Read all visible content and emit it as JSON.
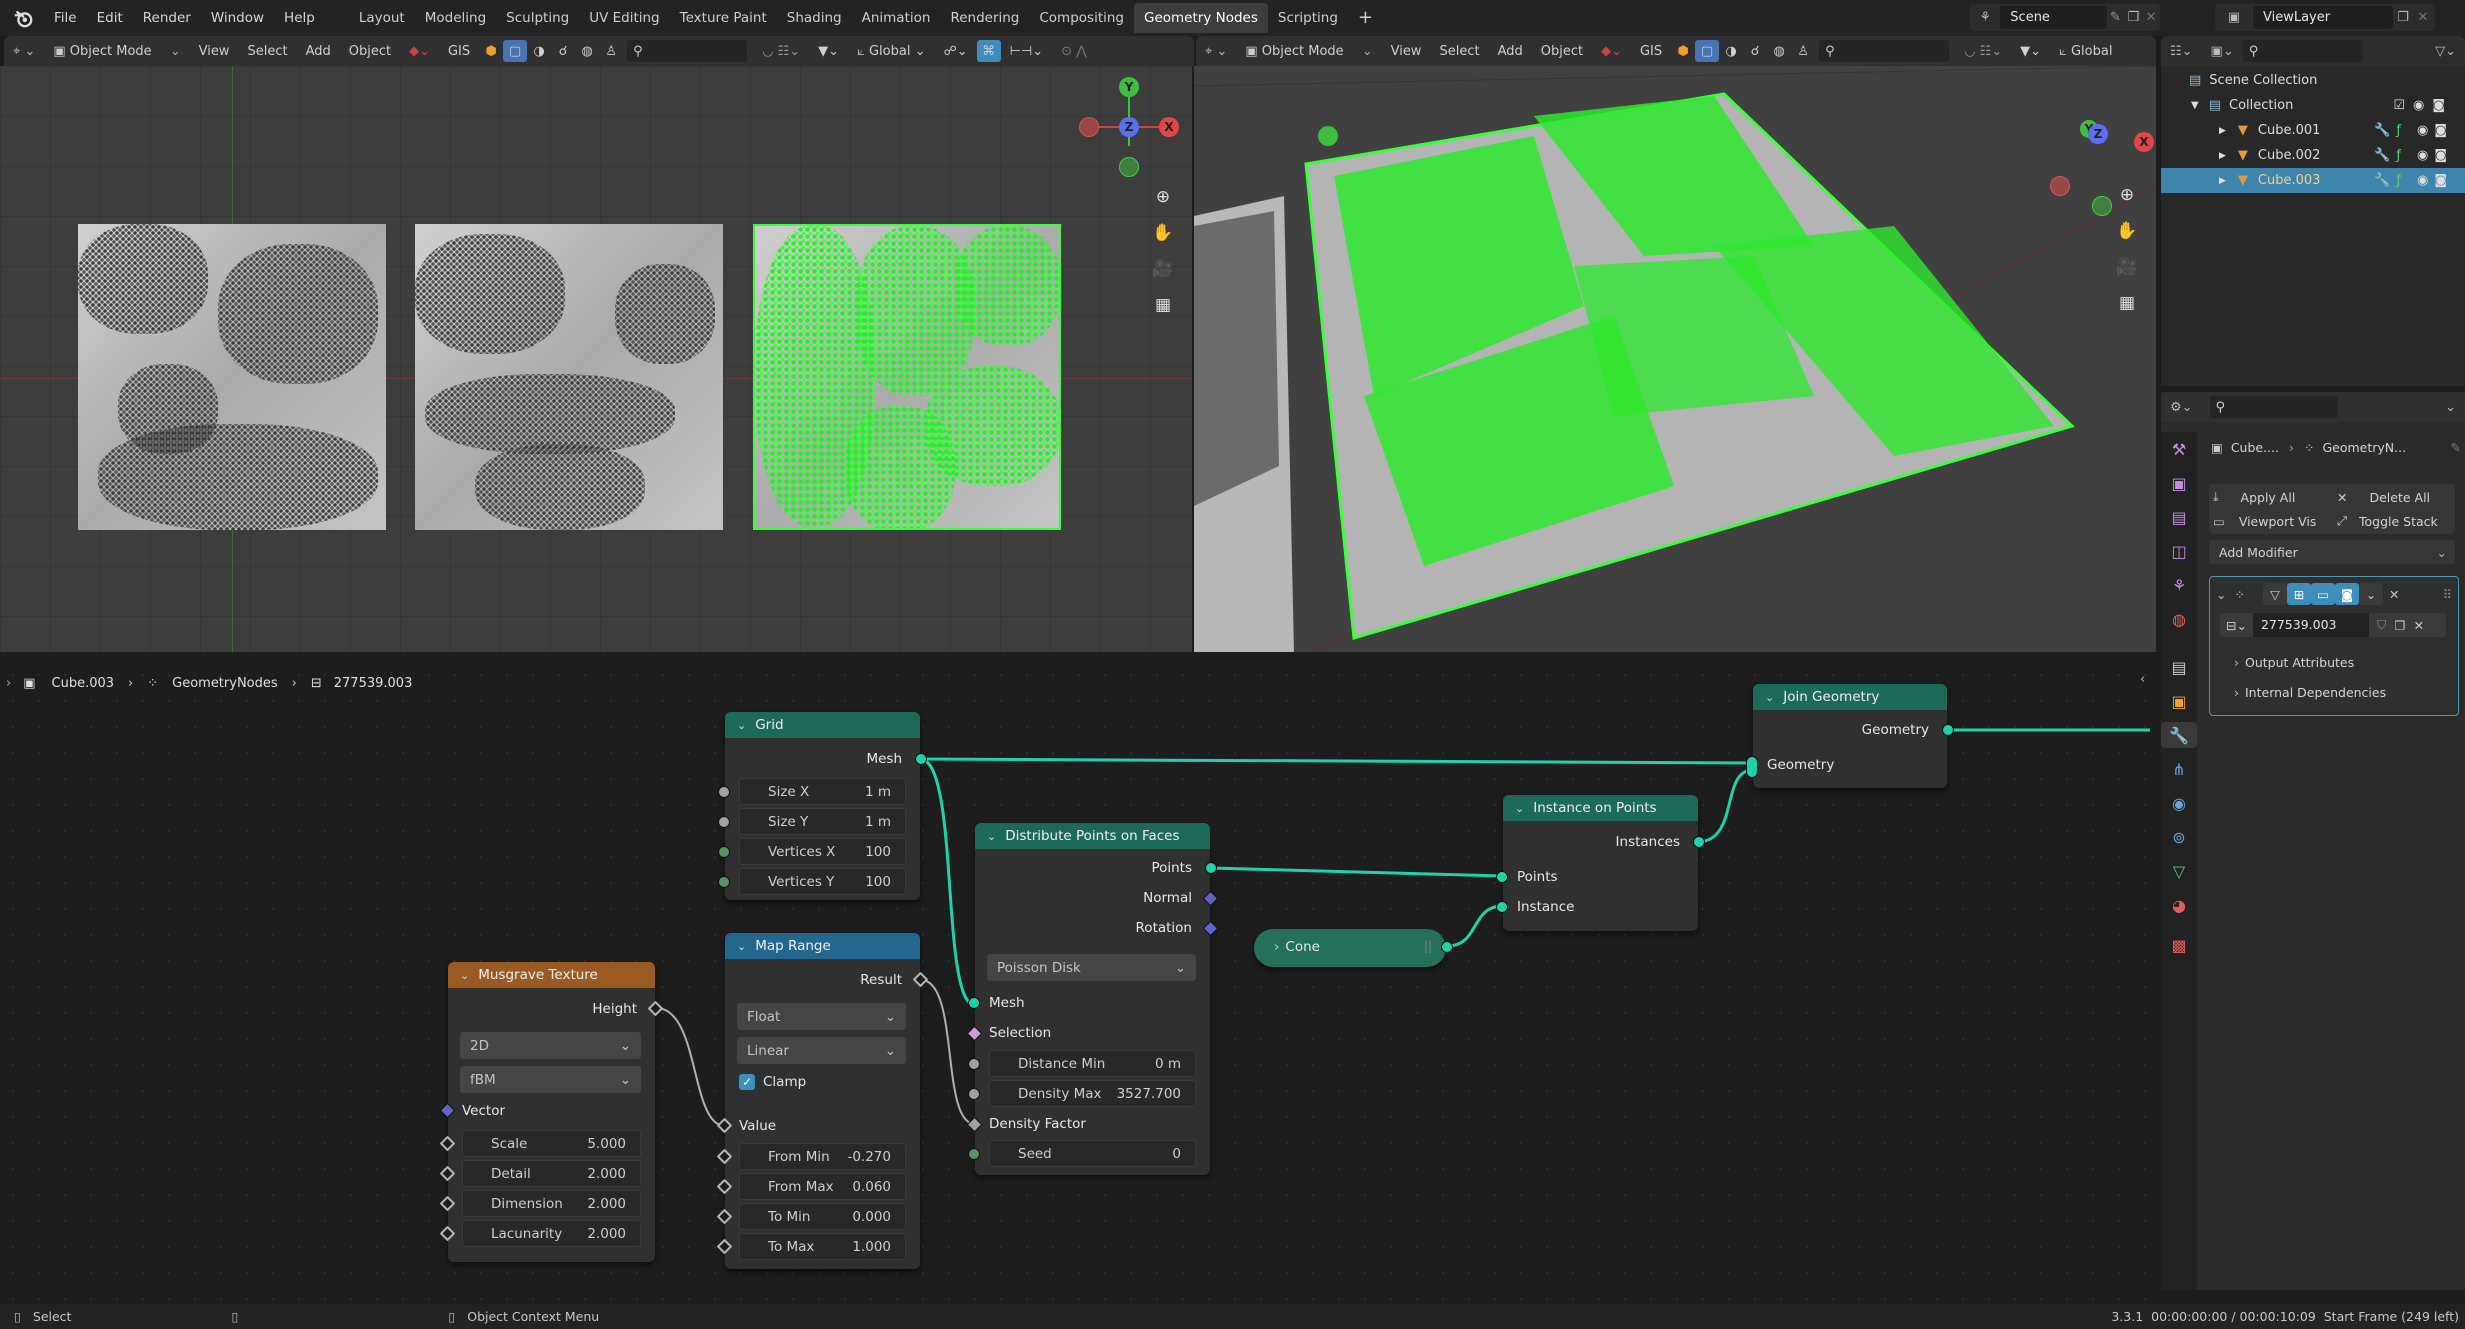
{
  "topbar": {
    "menus": [
      "File",
      "Edit",
      "Render",
      "Window",
      "Help"
    ],
    "workspaces": [
      "Layout",
      "Modeling",
      "Sculpting",
      "UV Editing",
      "Texture Paint",
      "Shading",
      "Animation",
      "Rendering",
      "Compositing",
      "Geometry Nodes",
      "Scripting"
    ],
    "active_workspace": "Geometry Nodes",
    "add_workspace": "+",
    "scene": "Scene",
    "view_layer": "ViewLayer"
  },
  "viewport_left": {
    "mode": "Object Mode",
    "menus": [
      "View",
      "Select",
      "Add",
      "Object"
    ],
    "gis": "GIS",
    "orientation": "Global"
  },
  "viewport_right": {
    "mode": "Object Mode",
    "menus": [
      "View",
      "Select",
      "Add",
      "Object"
    ],
    "gis": "GIS",
    "orientation": "Global"
  },
  "gizmo": {
    "x": "X",
    "y": "Y",
    "z": "Z"
  },
  "outliner": {
    "scene_collection": "Scene Collection",
    "collection": "Collection",
    "objects": [
      {
        "name": "Cube.001",
        "selected": false
      },
      {
        "name": "Cube.002",
        "selected": false
      },
      {
        "name": "Cube.003",
        "selected": true
      }
    ]
  },
  "properties": {
    "breadcrumb_object": "Cube....",
    "breadcrumb_modifier": "GeometryN...",
    "apply_all": "Apply All",
    "delete_all": "Delete All",
    "viewport_vis": "Viewport Vis",
    "toggle_stack": "Toggle Stack",
    "add_modifier": "Add Modifier",
    "node_group": "277539.003",
    "output_attributes": "Output Attributes",
    "internal_dependencies": "Internal Dependencies"
  },
  "node_editor": {
    "breadcrumb": [
      "Cube.003",
      "GeometryNodes",
      "277539.003"
    ],
    "nodes": {
      "grid": {
        "title": "Grid",
        "output": "Mesh",
        "fields": [
          {
            "label": "Size X",
            "value": "1 m"
          },
          {
            "label": "Size Y",
            "value": "1 m"
          },
          {
            "label": "Vertices X",
            "value": "100"
          },
          {
            "label": "Vertices Y",
            "value": "100"
          }
        ]
      },
      "musgrave": {
        "title": "Musgrave Texture",
        "output": "Height",
        "dimensions": "2D",
        "type": "fBM",
        "vector": "Vector",
        "fields": [
          {
            "label": "Scale",
            "value": "5.000"
          },
          {
            "label": "Detail",
            "value": "2.000"
          },
          {
            "label": "Dimension",
            "value": "2.000"
          },
          {
            "label": "Lacunarity",
            "value": "2.000"
          }
        ]
      },
      "map_range": {
        "title": "Map Range",
        "output": "Result",
        "data_type": "Float",
        "interpolation": "Linear",
        "clamp_label": "Clamp",
        "clamp": true,
        "value_input": "Value",
        "fields": [
          {
            "label": "From Min",
            "value": "-0.270"
          },
          {
            "label": "From Max",
            "value": "0.060"
          },
          {
            "label": "To Min",
            "value": "0.000"
          },
          {
            "label": "To Max",
            "value": "1.000"
          }
        ]
      },
      "distribute": {
        "title": "Distribute Points on Faces",
        "outputs": [
          "Points",
          "Normal",
          "Rotation"
        ],
        "method": "Poisson Disk",
        "mesh": "Mesh",
        "selection": "Selection",
        "distance_min_label": "Distance Min",
        "distance_min": "0 m",
        "density_max_label": "Density Max",
        "density_max": "3527.700",
        "density_factor": "Density Factor",
        "seed_label": "Seed",
        "seed": "0"
      },
      "cone": {
        "title": "Cone"
      },
      "instance_on_points": {
        "title": "Instance on Points",
        "output": "Instances",
        "inputs": [
          "Points",
          "Instance"
        ]
      },
      "join_geometry": {
        "title": "Join Geometry",
        "output": "Geometry",
        "input": "Geometry"
      }
    }
  },
  "statusbar": {
    "left_mouse": "Select",
    "right_mouse": "Object Context Menu",
    "info": "3.3.1  00:00:00:00 / 00:00:10:09  Start Frame (249 left)"
  },
  "colors": {
    "geometry_socket": "#1fd3a8",
    "selection_green": "#27f02a",
    "accent_blue": "#4772b3",
    "outliner_selected": "#3e85ae",
    "texture_header": "#9a5a22",
    "geometry_header": "#1d6a58",
    "converter_header": "#23678f"
  }
}
